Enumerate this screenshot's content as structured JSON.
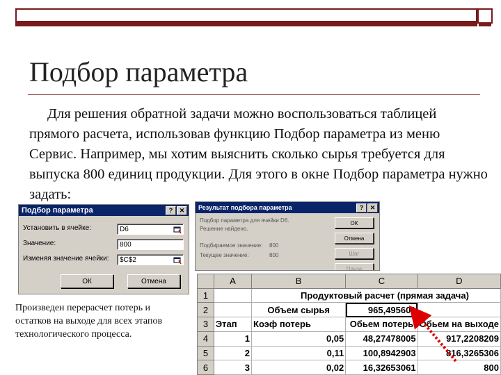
{
  "slide": {
    "title": "Подбор параметра",
    "paragraph": "Для решения обратной задачи можно воспользоваться таблицей прямого расчета, использовав функцию Подбор параметра из меню Сервис. Например, мы хотим выяснить сколько сырья требуется для выпуска 800 единиц продукции. Для этого в окне Подбор параметра нужно задать:",
    "caption": "Произведен перерасчет потерь и остатков на выходе для всех этапов технологического процесса."
  },
  "dialog1": {
    "title": "Подбор параметра",
    "help": "?",
    "close": "✕",
    "set_cell_label": "Установить в ячейке:",
    "set_cell_value": "D6",
    "value_label": "Значение:",
    "value_value": "800",
    "change_label": "Изменяя значение ячейки:",
    "change_value": "$C$2",
    "ok": "ОК",
    "cancel": "Отмена"
  },
  "dialog2": {
    "title": "Результат подбора параметра",
    "help": "?",
    "close": "✕",
    "line1": "Подбор параметра для ячейки D6.",
    "line2": "Решение найдено.",
    "target_label": "Подбираемое значение:",
    "target_value": "800",
    "current_label": "Текущее значение:",
    "current_value": "800",
    "ok": "ОК",
    "cancel": "Отмена",
    "step": "Шаг",
    "pause": "Пауза"
  },
  "sheet": {
    "columns": [
      "A",
      "B",
      "C",
      "D"
    ],
    "rows": [
      {
        "n": "1",
        "cells": [
          "",
          "Продуктовый расчет (прямая задача)",
          "",
          ""
        ]
      },
      {
        "n": "2",
        "cells": [
          "",
          "Объем сырья",
          "965,495601",
          ""
        ]
      },
      {
        "n": "3",
        "cells": [
          "Этап",
          "Коэф потерь",
          "Обьем потерь",
          "Обьем на выходе"
        ]
      },
      {
        "n": "4",
        "cells": [
          "1",
          "0,05",
          "48,27478005",
          "917,2208209"
        ]
      },
      {
        "n": "5",
        "cells": [
          "2",
          "0,11",
          "100,8942903",
          "816,3265306"
        ]
      },
      {
        "n": "6",
        "cells": [
          "3",
          "0,02",
          "16,32653061",
          "800"
        ]
      }
    ]
  }
}
